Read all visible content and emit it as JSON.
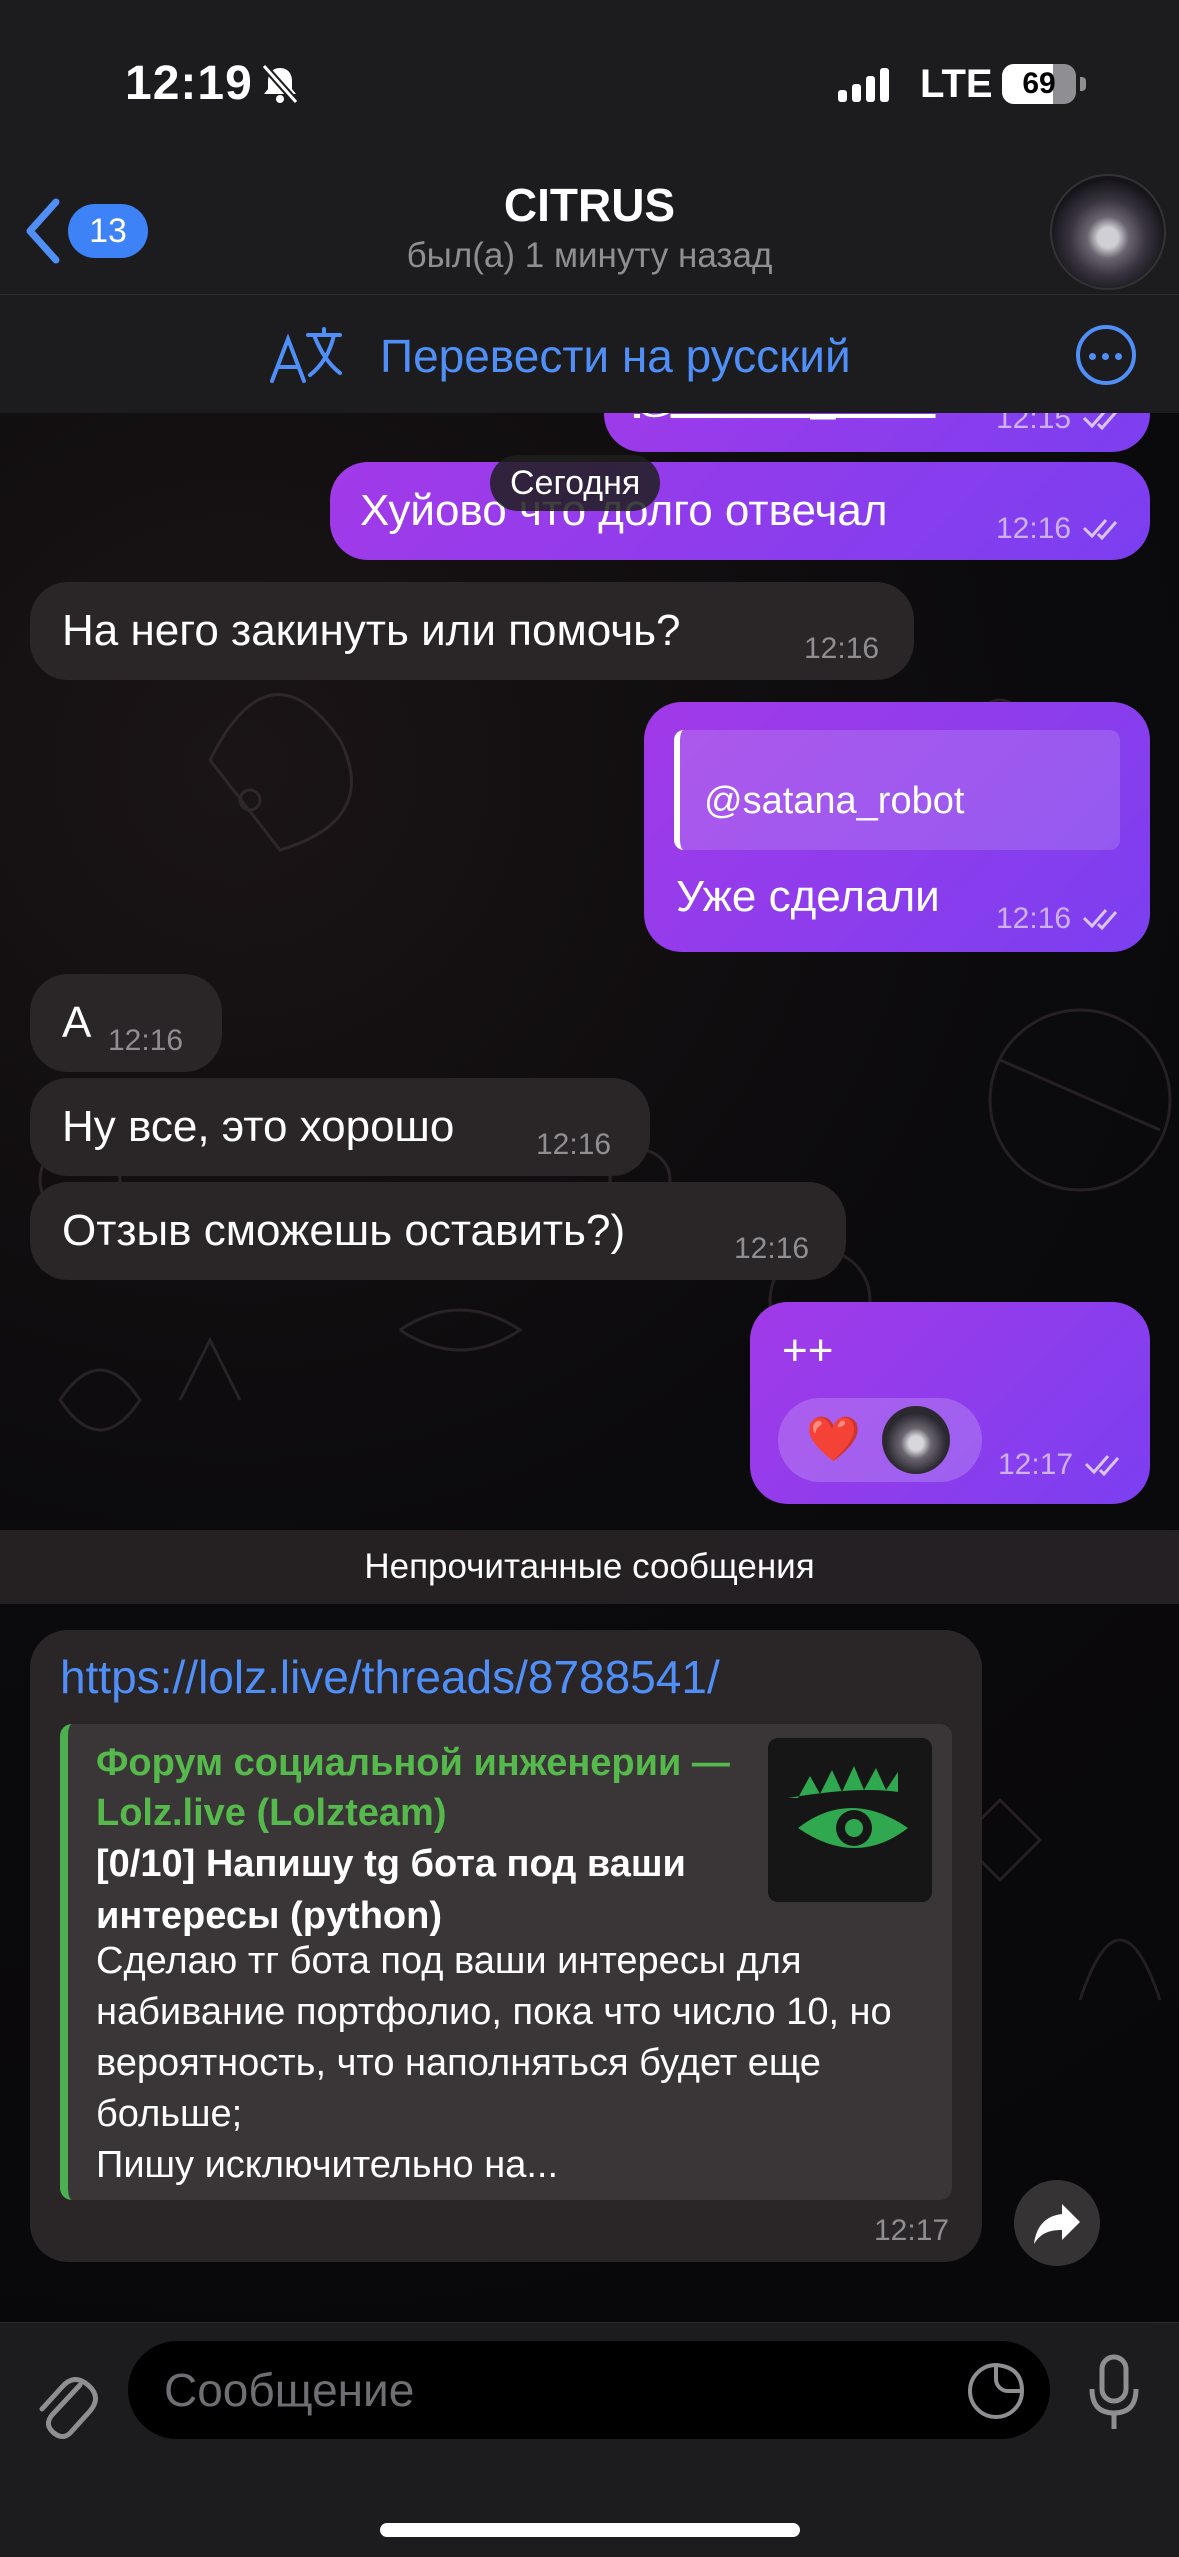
{
  "status_bar": {
    "time": "12:19",
    "network": "LTE",
    "battery": "69",
    "battery_level": 0.69
  },
  "header": {
    "back_count": "13",
    "title": "CITRUS",
    "subtitle": "был(а) 1 минуту назад"
  },
  "translate_bar": {
    "label": "Перевести на русский"
  },
  "date_separator": "Сегодня",
  "messages": [
    {
      "dir": "out",
      "text": "@satana_robot",
      "time": "12:15"
    },
    {
      "dir": "out",
      "text": "Хуйово что долго отвечал",
      "time": "12:16"
    },
    {
      "dir": "in",
      "text": "На него закинуть или помочь?",
      "time": "12:16"
    },
    {
      "dir": "out",
      "reply_to": "@satana_robot",
      "text": "Уже сделали",
      "time": "12:16"
    },
    {
      "dir": "in",
      "text": "А",
      "time": "12:16"
    },
    {
      "dir": "in",
      "text": "Ну все, это хорошо",
      "time": "12:16"
    },
    {
      "dir": "in",
      "text": "Отзыв сможешь оставить?)",
      "time": "12:16"
    },
    {
      "dir": "out",
      "text": "++",
      "time": "12:17",
      "reaction": "❤️"
    }
  ],
  "unread_label": "Непрочитанные сообщения",
  "link_message": {
    "url": "https://lolz.live/threads/8788541/",
    "site": "Форум социальной инженерии — Lolz.live (Lolzteam)",
    "title": "[0/10] Напишу tg бота под ваши интересы (python)",
    "description": "Сделаю тг бота под ваши интересы для набивание портфолио, пока что число 10, но вероятность, что наполняться будет еще больше;\nПишу исключительно на...",
    "time": "12:17"
  },
  "composer": {
    "placeholder": "Сообщение"
  },
  "colors": {
    "accent": "#4f8ff7",
    "outgoing": "#8b3cf0",
    "incoming": "#2a2627",
    "link_site": "#55b94c"
  }
}
